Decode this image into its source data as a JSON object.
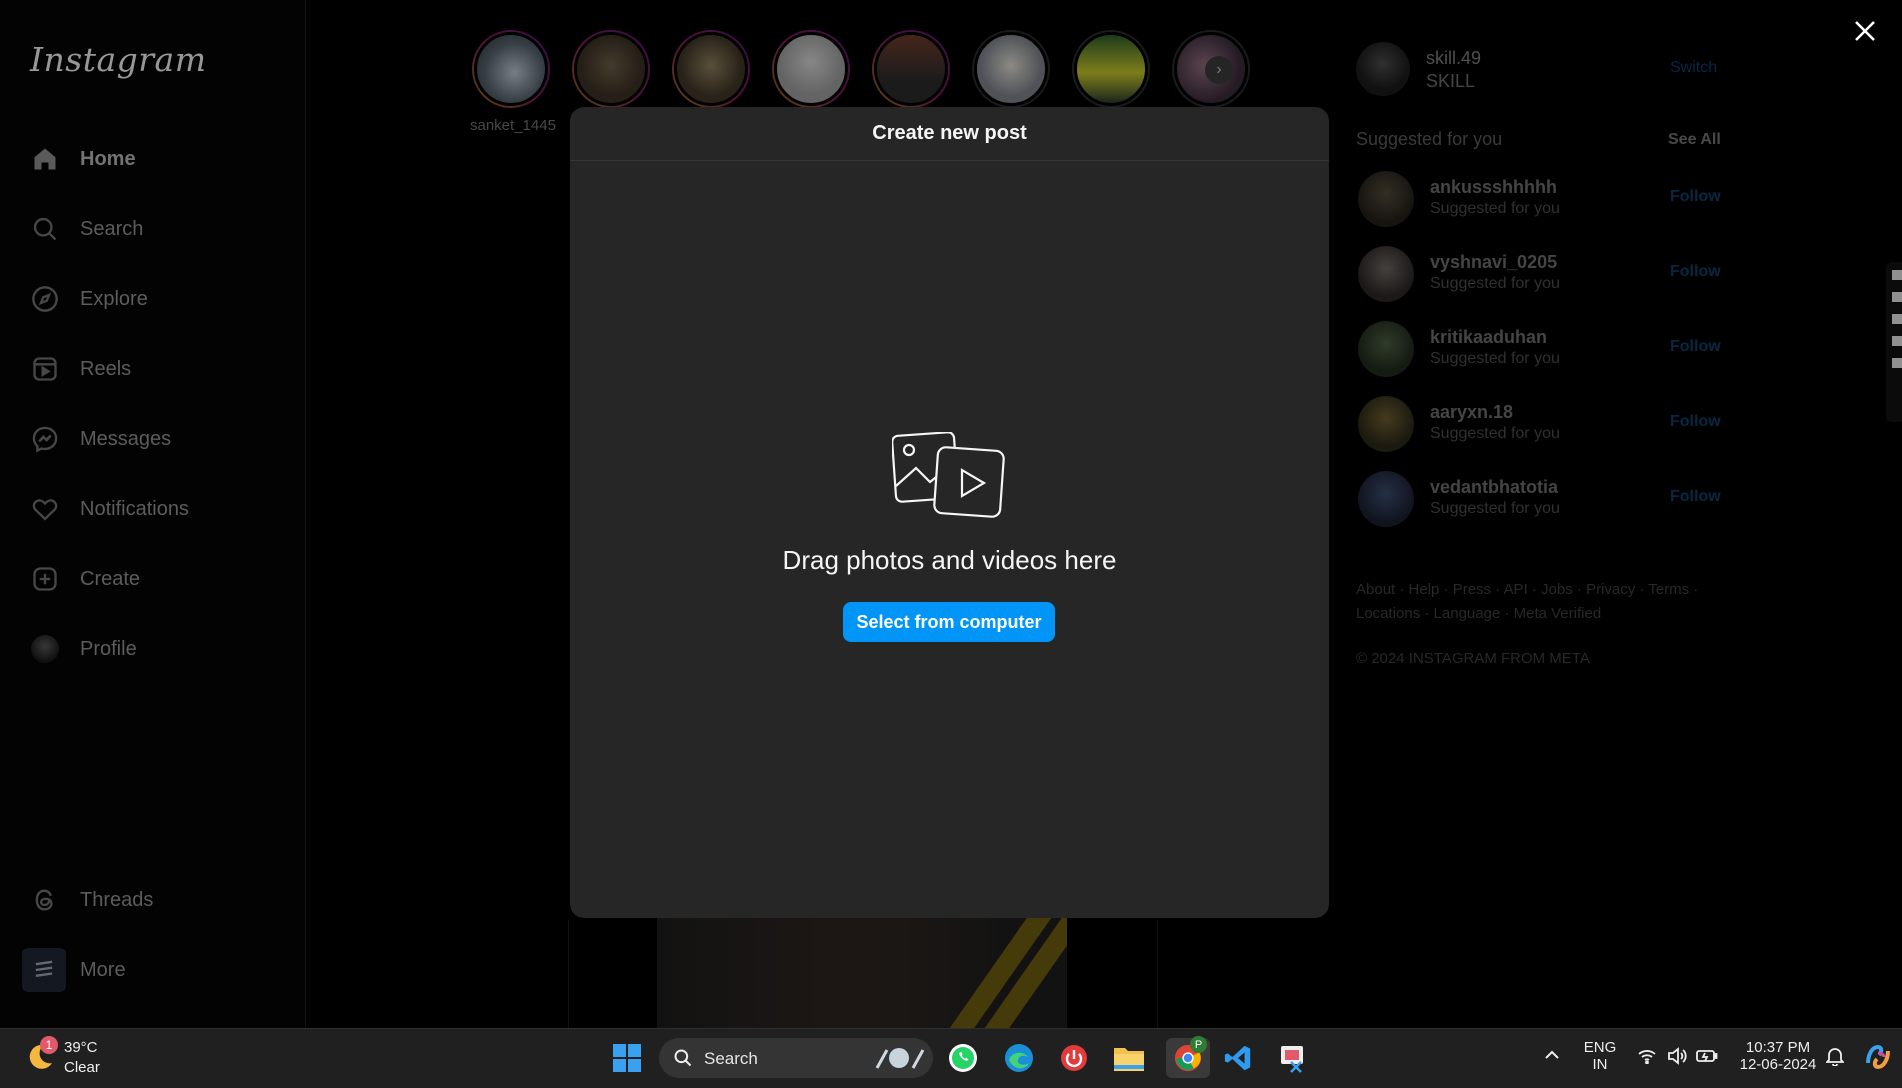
{
  "app": {
    "logo": "Instagram",
    "nav": [
      {
        "label": "Home",
        "icon": "home-icon"
      },
      {
        "label": "Search",
        "icon": "search-icon"
      },
      {
        "label": "Explore",
        "icon": "compass-icon"
      },
      {
        "label": "Reels",
        "icon": "reels-icon"
      },
      {
        "label": "Messages",
        "icon": "messenger-icon"
      },
      {
        "label": "Notifications",
        "icon": "heart-icon"
      },
      {
        "label": "Create",
        "icon": "plus-square-icon"
      },
      {
        "label": "Profile",
        "icon": "avatar"
      }
    ],
    "nav_bottom": [
      {
        "label": "Threads",
        "icon": "threads-icon"
      },
      {
        "label": "More",
        "icon": "menu-icon"
      }
    ],
    "stories": {
      "first_name": "sanket_1445"
    },
    "account": {
      "username": "skill.49",
      "full_name": "SKILL",
      "switch_label": "Switch"
    },
    "suggestions": {
      "heading": "Suggested for you",
      "see_all": "See All",
      "items": [
        {
          "username": "ankussshhhhh",
          "subtitle": "Suggested for you",
          "action": "Follow"
        },
        {
          "username": "vyshnavi_0205",
          "subtitle": "Suggested for you",
          "action": "Follow"
        },
        {
          "username": "kritikaaduhan",
          "subtitle": "Suggested for you",
          "action": "Follow"
        },
        {
          "username": "aaryxn.18",
          "subtitle": "Suggested for you",
          "action": "Follow"
        },
        {
          "username": "vedantbhatotia",
          "subtitle": "Suggested for you",
          "action": "Follow"
        }
      ]
    },
    "footer": {
      "links_line1": "About · Help · Press · API · Jobs · Privacy · Terms ·",
      "links_line2": "Locations · Language · Meta Verified",
      "copyright": "© 2024 INSTAGRAM FROM META"
    }
  },
  "modal": {
    "title": "Create new post",
    "drag_text": "Drag photos and videos here",
    "button_label": "Select from computer"
  },
  "taskbar": {
    "weather_badge": "1",
    "temperature": "39°C",
    "condition": "Clear",
    "search_label": "Search",
    "lang_line1": "ENG",
    "lang_line2": "IN",
    "time": "10:37 PM",
    "date": "12-06-2024",
    "chrome_profile_badge": "P"
  },
  "colors": {
    "accent_blue": "#0095f6",
    "modal_bg": "#262626",
    "taskbar_bg": "#202020"
  }
}
